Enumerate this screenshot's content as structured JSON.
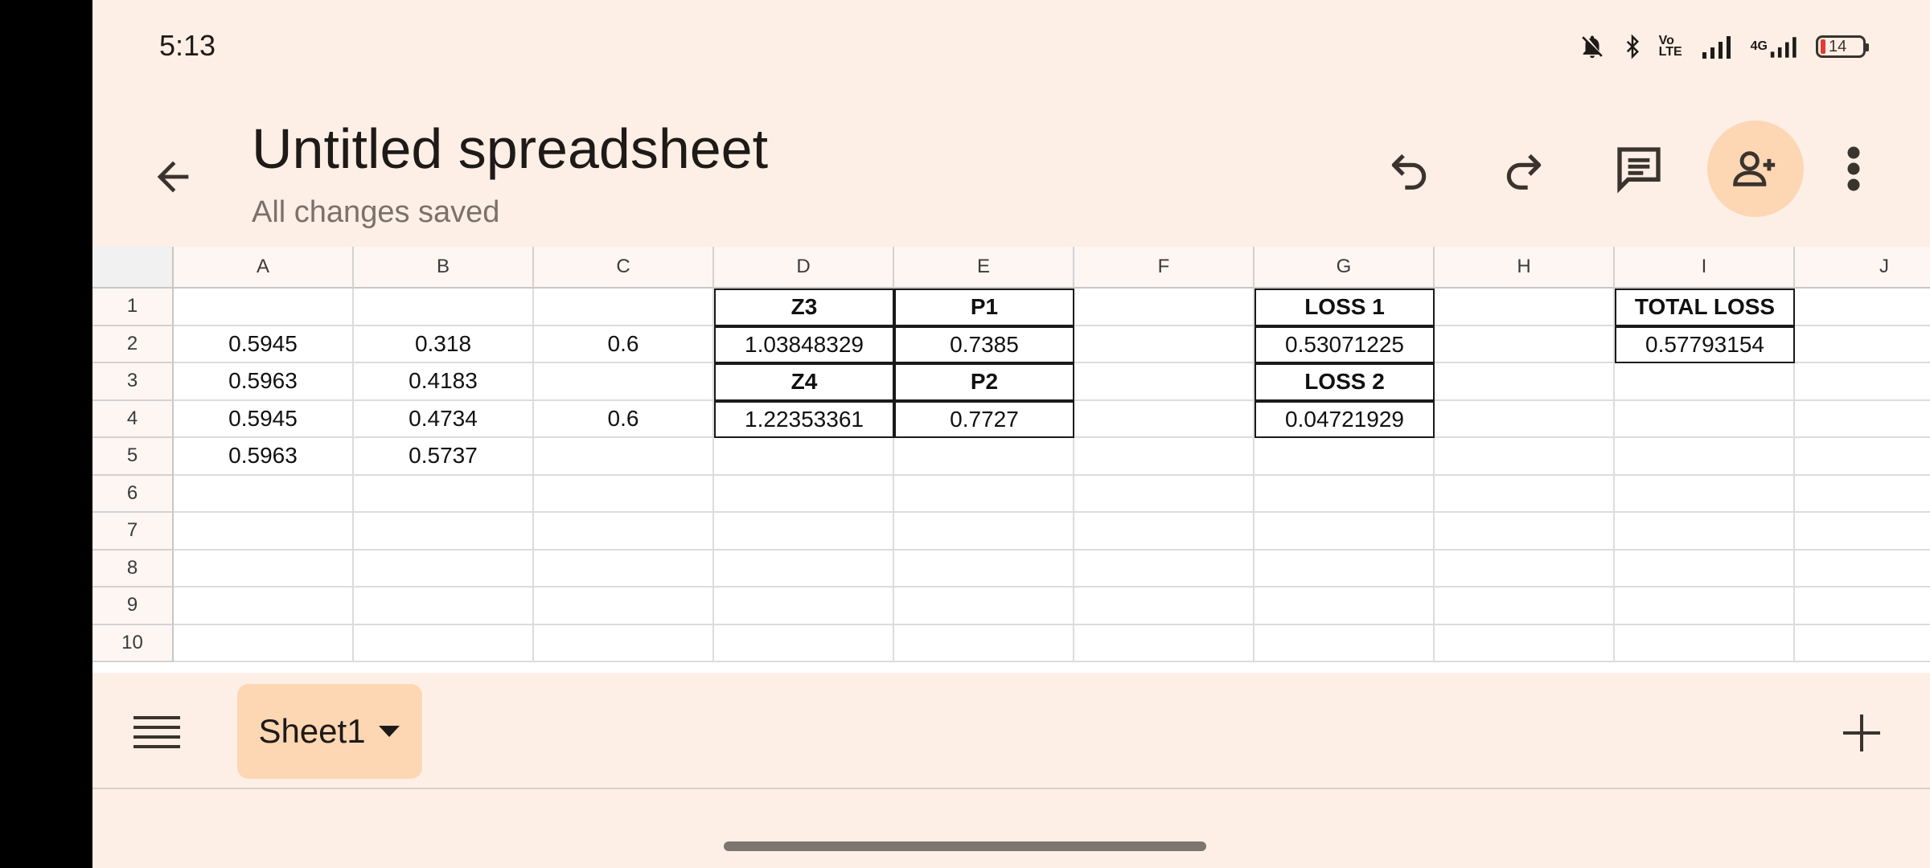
{
  "status_bar": {
    "time": "5:13",
    "network_volte": "Vo LTE",
    "network_type": "4G",
    "battery_level": "14"
  },
  "app_bar": {
    "title": "Untitled spreadsheet",
    "save_status": "All changes saved"
  },
  "grid": {
    "columns": [
      "A",
      "B",
      "C",
      "D",
      "E",
      "F",
      "G",
      "H",
      "I",
      "J"
    ],
    "rows": [
      "1",
      "2",
      "3",
      "4",
      "5",
      "6",
      "7",
      "8",
      "9",
      "10"
    ],
    "cells": {
      "D1": "Z3",
      "E1": "P1",
      "G1": "LOSS 1",
      "I1": "TOTAL LOSS",
      "A2": "0.5945",
      "B2": "0.318",
      "C2": "0.6",
      "D2": "1.03848329",
      "E2": "0.7385",
      "G2": "0.53071225",
      "I2": "0.57793154",
      "A3": "0.5963",
      "B3": "0.4183",
      "D3": "Z4",
      "E3": "P2",
      "G3": "LOSS 2",
      "A4": "0.5945",
      "B4": "0.4734",
      "C4": "0.6",
      "D4": "1.22353361",
      "E4": "0.7727",
      "G4": "0.04721929",
      "A5": "0.5963",
      "B5": "0.5737"
    }
  },
  "bottom_bar": {
    "active_sheet": "Sheet1"
  },
  "colors": {
    "background": "#fdefe5",
    "accent": "#fdd6b4",
    "text": "#1e1a17"
  }
}
